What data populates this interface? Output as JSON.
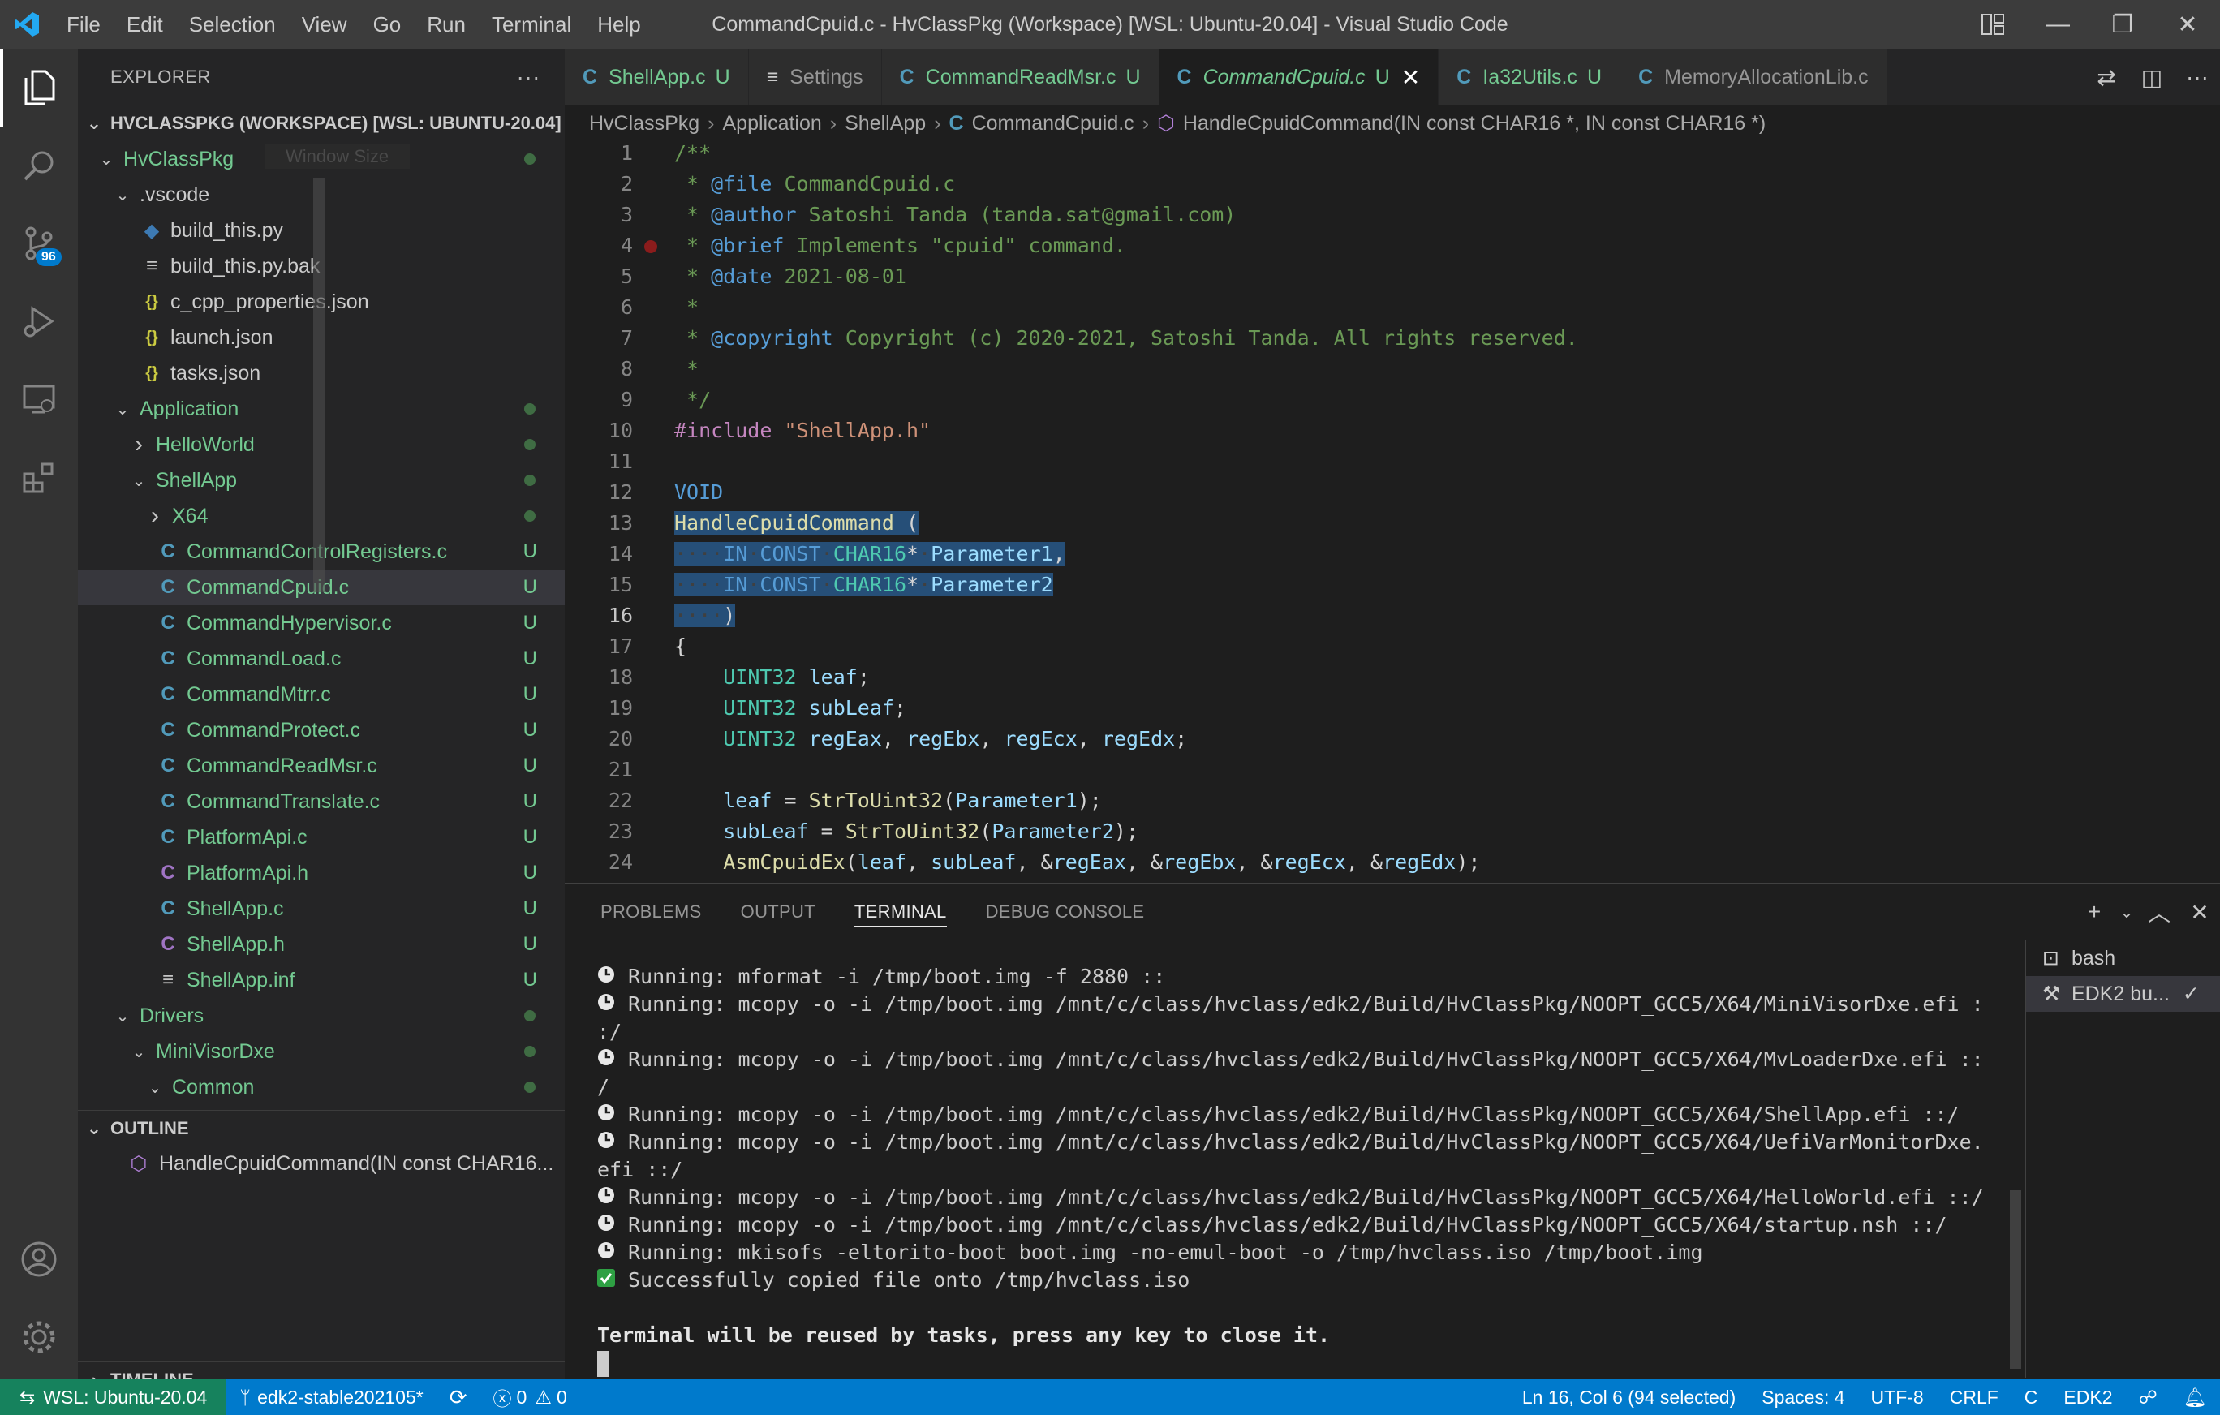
{
  "window": {
    "title": "CommandCpuid.c - HvClassPkg (Workspace) [WSL: Ubuntu-20.04] - Visual Studio Code"
  },
  "menu": [
    "File",
    "Edit",
    "Selection",
    "View",
    "Go",
    "Run",
    "Terminal",
    "Help"
  ],
  "activity": {
    "scm_badge": "96"
  },
  "explorer": {
    "title": "EXPLORER",
    "more": "···",
    "workspace": "HVCLASSPKG (WORKSPACE) [WSL: UBUNTU-20.04]",
    "ghost_label": "Window Size",
    "items": [
      {
        "label": "HvClassPkg",
        "depth": 0,
        "chev": "v",
        "kind": "folder",
        "color": "green",
        "deco": "dot"
      },
      {
        "label": ".vscode",
        "depth": 1,
        "chev": "v",
        "kind": "folder",
        "color": "plain",
        "deco": ""
      },
      {
        "label": "build_this.py",
        "depth": 2,
        "chev": "",
        "kind": "py",
        "color": "plain",
        "deco": ""
      },
      {
        "label": "build_this.py.bak",
        "depth": 2,
        "chev": "",
        "kind": "txt",
        "color": "plain",
        "deco": ""
      },
      {
        "label": "c_cpp_properties.json",
        "depth": 2,
        "chev": "",
        "kind": "json",
        "color": "plain",
        "deco": ""
      },
      {
        "label": "launch.json",
        "depth": 2,
        "chev": "",
        "kind": "json",
        "color": "plain",
        "deco": ""
      },
      {
        "label": "tasks.json",
        "depth": 2,
        "chev": "",
        "kind": "json",
        "color": "plain",
        "deco": ""
      },
      {
        "label": "Application",
        "depth": 1,
        "chev": "v",
        "kind": "folder",
        "color": "green",
        "deco": "dot"
      },
      {
        "label": "HelloWorld",
        "depth": 2,
        "chev": ">",
        "kind": "folder",
        "color": "green",
        "deco": "dot"
      },
      {
        "label": "ShellApp",
        "depth": 2,
        "chev": "v",
        "kind": "folder",
        "color": "green",
        "deco": "dot"
      },
      {
        "label": "X64",
        "depth": 3,
        "chev": ">",
        "kind": "folder",
        "color": "green",
        "deco": "dot"
      },
      {
        "label": "CommandControlRegisters.c",
        "depth": 3,
        "chev": "",
        "kind": "c",
        "color": "green",
        "deco": "U"
      },
      {
        "label": "CommandCpuid.c",
        "depth": 3,
        "chev": "",
        "kind": "c",
        "color": "green",
        "deco": "U",
        "selected": true
      },
      {
        "label": "CommandHypervisor.c",
        "depth": 3,
        "chev": "",
        "kind": "c",
        "color": "green",
        "deco": "U"
      },
      {
        "label": "CommandLoad.c",
        "depth": 3,
        "chev": "",
        "kind": "c",
        "color": "green",
        "deco": "U"
      },
      {
        "label": "CommandMtrr.c",
        "depth": 3,
        "chev": "",
        "kind": "c",
        "color": "green",
        "deco": "U"
      },
      {
        "label": "CommandProtect.c",
        "depth": 3,
        "chev": "",
        "kind": "c",
        "color": "green",
        "deco": "U"
      },
      {
        "label": "CommandReadMsr.c",
        "depth": 3,
        "chev": "",
        "kind": "c",
        "color": "green",
        "deco": "U"
      },
      {
        "label": "CommandTranslate.c",
        "depth": 3,
        "chev": "",
        "kind": "c",
        "color": "green",
        "deco": "U"
      },
      {
        "label": "PlatformApi.c",
        "depth": 3,
        "chev": "",
        "kind": "c",
        "color": "green",
        "deco": "U"
      },
      {
        "label": "PlatformApi.h",
        "depth": 3,
        "chev": "",
        "kind": "h",
        "color": "green",
        "deco": "U"
      },
      {
        "label": "ShellApp.c",
        "depth": 3,
        "chev": "",
        "kind": "c",
        "color": "green",
        "deco": "U"
      },
      {
        "label": "ShellApp.h",
        "depth": 3,
        "chev": "",
        "kind": "h",
        "color": "green",
        "deco": "U"
      },
      {
        "label": "ShellApp.inf",
        "depth": 3,
        "chev": "",
        "kind": "txt",
        "color": "green",
        "deco": "U"
      },
      {
        "label": "Drivers",
        "depth": 1,
        "chev": "v",
        "kind": "folder",
        "color": "green",
        "deco": "dot"
      },
      {
        "label": "MiniVisorDxe",
        "depth": 2,
        "chev": "v",
        "kind": "folder",
        "color": "green",
        "deco": "dot"
      },
      {
        "label": "Common",
        "depth": 3,
        "chev": "v",
        "kind": "folder",
        "color": "green",
        "deco": "dot"
      }
    ],
    "outline_title": "OUTLINE",
    "outline_item": "HandleCpuidCommand(IN const CHAR16...",
    "timeline_title": "TIMELINE"
  },
  "tabs": [
    {
      "label": "ShellApp.c",
      "icon": "C",
      "deco": "U",
      "active": false
    },
    {
      "label": "Settings",
      "icon": "≡",
      "deco": "",
      "active": false
    },
    {
      "label": "CommandReadMsr.c",
      "icon": "C",
      "deco": "U",
      "active": false
    },
    {
      "label": "CommandCpuid.c",
      "icon": "C",
      "deco": "U",
      "active": true
    },
    {
      "label": "Ia32Utils.c",
      "icon": "C",
      "deco": "U",
      "active": false
    },
    {
      "label": "MemoryAllocationLib.c",
      "icon": "C",
      "deco": "",
      "active": false
    }
  ],
  "breadcrumb": [
    "HvClassPkg",
    "Application",
    "ShellApp",
    "CommandCpuid.c",
    "HandleCpuidCommand(IN const CHAR16 *, IN const CHAR16 *)"
  ],
  "editor": {
    "current_line": 16,
    "lines": [
      [
        [
          "c-com",
          "/**"
        ]
      ],
      [
        [
          "c-com",
          " * "
        ],
        [
          "c-doc",
          "@file"
        ],
        [
          "c-com",
          " CommandCpuid.c"
        ]
      ],
      [
        [
          "c-com",
          " * "
        ],
        [
          "c-doc",
          "@author"
        ],
        [
          "c-com",
          " Satoshi Tanda (tanda.sat@gmail.com)"
        ]
      ],
      [
        [
          "c-com",
          " * "
        ],
        [
          "c-doc",
          "@brief"
        ],
        [
          "c-com",
          " Implements \"cpuid\" command."
        ]
      ],
      [
        [
          "c-com",
          " * "
        ],
        [
          "c-doc",
          "@date"
        ],
        [
          "c-com",
          " 2021-08-01"
        ]
      ],
      [
        [
          "c-com",
          " *"
        ]
      ],
      [
        [
          "c-com",
          " * "
        ],
        [
          "c-doc",
          "@copyright"
        ],
        [
          "c-com",
          " Copyright (c) 2020-2021, Satoshi Tanda. All rights reserved."
        ]
      ],
      [
        [
          "c-com",
          " *"
        ]
      ],
      [
        [
          "c-com",
          " */"
        ]
      ],
      [
        [
          "c-kw",
          "#include"
        ],
        [
          "",
          ""
        ],
        [
          "c-str",
          " \"ShellApp.h\""
        ]
      ],
      [],
      [
        [
          "c-bl",
          "VOID"
        ]
      ],
      [
        [
          "sel c-fn",
          "HandleCpuidCommand"
        ],
        [
          "sel",
          " ("
        ]
      ],
      [
        [
          "sel ws",
          "····"
        ],
        [
          "sel c-bl",
          "IN"
        ],
        [
          "sel ws",
          "·"
        ],
        [
          "sel c-bl",
          "CONST"
        ],
        [
          "sel ws",
          "·"
        ],
        [
          "sel c-type",
          "CHAR16"
        ],
        [
          "sel",
          "*"
        ],
        [
          "sel ws",
          "·"
        ],
        [
          "sel c-var",
          "Parameter1"
        ],
        [
          "sel",
          ","
        ]
      ],
      [
        [
          "sel ws",
          "····"
        ],
        [
          "sel c-bl",
          "IN"
        ],
        [
          "sel ws",
          "·"
        ],
        [
          "sel c-bl",
          "CONST"
        ],
        [
          "sel ws",
          "·"
        ],
        [
          "sel c-type",
          "CHAR16"
        ],
        [
          "sel",
          "*"
        ],
        [
          "sel ws",
          "·"
        ],
        [
          "sel c-var",
          "Parameter2"
        ]
      ],
      [
        [
          "sel ws",
          "····"
        ],
        [
          "sel",
          ")"
        ]
      ],
      [
        [
          "",
          "{"
        ]
      ],
      [
        [
          "",
          "    "
        ],
        [
          "c-type",
          "UINT32"
        ],
        [
          "",
          " "
        ],
        [
          "c-var",
          "leaf"
        ],
        [
          "",
          ";"
        ]
      ],
      [
        [
          "",
          "    "
        ],
        [
          "c-type",
          "UINT32"
        ],
        [
          "",
          " "
        ],
        [
          "c-var",
          "subLeaf"
        ],
        [
          "",
          ";"
        ]
      ],
      [
        [
          "",
          "    "
        ],
        [
          "c-type",
          "UINT32"
        ],
        [
          "",
          " "
        ],
        [
          "c-var",
          "regEax"
        ],
        [
          "",
          ", "
        ],
        [
          "c-var",
          "regEbx"
        ],
        [
          "",
          ", "
        ],
        [
          "c-var",
          "regEcx"
        ],
        [
          "",
          ", "
        ],
        [
          "c-var",
          "regEdx"
        ],
        [
          "",
          ";"
        ]
      ],
      [],
      [
        [
          "",
          "    "
        ],
        [
          "c-var",
          "leaf"
        ],
        [
          "",
          " = "
        ],
        [
          "c-fn",
          "StrToUint32"
        ],
        [
          "",
          "("
        ],
        [
          "c-var",
          "Parameter1"
        ],
        [
          "",
          ");"
        ]
      ],
      [
        [
          "",
          "    "
        ],
        [
          "c-var",
          "subLeaf"
        ],
        [
          "",
          " = "
        ],
        [
          "c-fn",
          "StrToUint32"
        ],
        [
          "",
          "("
        ],
        [
          "c-var",
          "Parameter2"
        ],
        [
          "",
          ");"
        ]
      ],
      [
        [
          "",
          "    "
        ],
        [
          "c-fn",
          "AsmCpuidEx"
        ],
        [
          "",
          "("
        ],
        [
          "c-var",
          "leaf"
        ],
        [
          "",
          ", "
        ],
        [
          "c-var",
          "subLeaf"
        ],
        [
          "",
          ", &"
        ],
        [
          "c-var",
          "regEax"
        ],
        [
          "",
          ", &"
        ],
        [
          "c-var",
          "regEbx"
        ],
        [
          "",
          ", &"
        ],
        [
          "c-var",
          "regEcx"
        ],
        [
          "",
          ", &"
        ],
        [
          "c-var",
          "regEdx"
        ],
        [
          "",
          ");"
        ]
      ]
    ]
  },
  "panel": {
    "tabs": [
      "PROBLEMS",
      "OUTPUT",
      "TERMINAL",
      "DEBUG CONSOLE"
    ],
    "active_tab": "TERMINAL",
    "terminal_lines": [
      {
        "icon": "clock",
        "text": "Running: mformat -i /tmp/boot.img -f 2880 ::"
      },
      {
        "icon": "clock",
        "text": "Running: mcopy -o -i /tmp/boot.img /mnt/c/class/hvclass/edk2/Build/HvClassPkg/NOOPT_GCC5/X64/MiniVisorDxe.efi :"
      },
      {
        "icon": "",
        "text": ":/"
      },
      {
        "icon": "clock",
        "text": "Running: mcopy -o -i /tmp/boot.img /mnt/c/class/hvclass/edk2/Build/HvClassPkg/NOOPT_GCC5/X64/MvLoaderDxe.efi ::"
      },
      {
        "icon": "",
        "text": "/"
      },
      {
        "icon": "clock",
        "text": "Running: mcopy -o -i /tmp/boot.img /mnt/c/class/hvclass/edk2/Build/HvClassPkg/NOOPT_GCC5/X64/ShellApp.efi ::/"
      },
      {
        "icon": "clock",
        "text": "Running: mcopy -o -i /tmp/boot.img /mnt/c/class/hvclass/edk2/Build/HvClassPkg/NOOPT_GCC5/X64/UefiVarMonitorDxe."
      },
      {
        "icon": "",
        "text": "efi ::/"
      },
      {
        "icon": "clock",
        "text": "Running: mcopy -o -i /tmp/boot.img /mnt/c/class/hvclass/edk2/Build/HvClassPkg/NOOPT_GCC5/X64/HelloWorld.efi ::/"
      },
      {
        "icon": "clock",
        "text": "Running: mcopy -o -i /tmp/boot.img /mnt/c/class/hvclass/edk2/Build/HvClassPkg/NOOPT_GCC5/X64/startup.nsh ::/"
      },
      {
        "icon": "clock",
        "text": "Running: mkisofs -eltorito-boot boot.img -no-emul-boot -o /tmp/hvclass.iso /tmp/boot.img"
      },
      {
        "icon": "check",
        "text": "Successfully copied file onto /tmp/hvclass.iso"
      },
      {
        "icon": "",
        "text": ""
      },
      {
        "icon": "",
        "text": "Terminal will be reused by tasks, press any key to close it.",
        "bold": true
      }
    ],
    "terminals": [
      {
        "label": "bash",
        "active": false
      },
      {
        "label": "EDK2 bu...",
        "active": true
      }
    ]
  },
  "status": {
    "remote": "WSL: Ubuntu-20.04",
    "branch": "edk2-stable202105*",
    "errors": "0",
    "warnings": "0",
    "position": "Ln 16, Col 6 (94 selected)",
    "spaces": "Spaces: 4",
    "encoding": "UTF-8",
    "eol": "CRLF",
    "language": "C",
    "config": "EDK2"
  },
  "colors": {
    "accent": "#007acc",
    "remote": "#16825d",
    "untracked": "#73c991"
  }
}
